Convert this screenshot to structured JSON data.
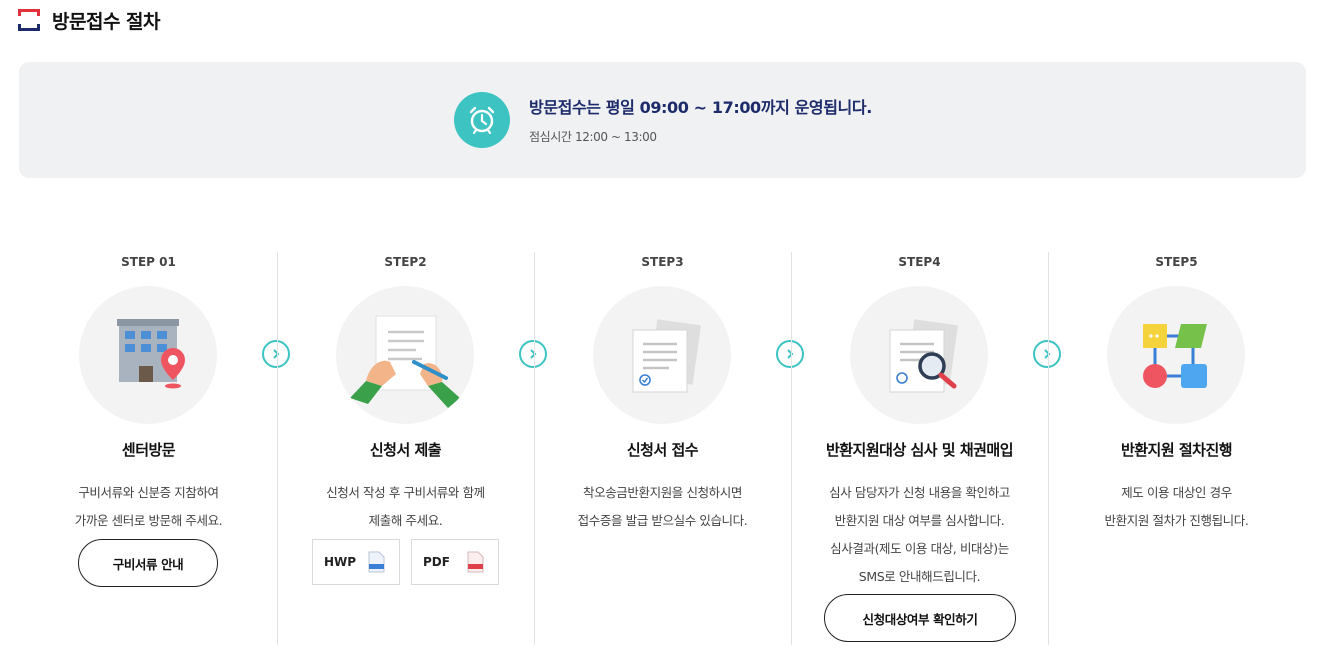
{
  "page": {
    "title": "방문접수 절차"
  },
  "notice": {
    "main": "방문접수는 평일 09:00 ~ 17:00까지 운영됩니다.",
    "sub": "점심시간 12:00 ~ 13:00",
    "icon": "alarm-clock-icon"
  },
  "colors": {
    "accent": "#3cc3c2",
    "navy": "#1d2b6b",
    "red": "#e0303b"
  },
  "steps": [
    {
      "label": "STEP 01",
      "title": "센터방문",
      "desc": [
        "구비서류와 신분증 지참하여",
        "가까운 센터로 방문해 주세요."
      ],
      "button": "구비서류 안내",
      "icon": "building-location-icon"
    },
    {
      "label": "STEP2",
      "title": "신청서 제출",
      "desc": [
        "신청서 작성 후 구비서류와 함께",
        "제출해 주세요."
      ],
      "files": [
        {
          "label": "HWP",
          "icon": "hwp-file-icon"
        },
        {
          "label": "PDF",
          "icon": "pdf-file-icon"
        }
      ],
      "icon": "hands-writing-icon"
    },
    {
      "label": "STEP3",
      "title": "신청서 접수",
      "desc": [
        "착오송금반환지원을 신청하시면",
        "접수증을 발급 받으실수 있습니다."
      ],
      "icon": "document-receipt-icon"
    },
    {
      "label": "STEP4",
      "title": "반환지원대상 심사 및 채권매입",
      "desc": [
        "심사 담당자가 신청 내용을 확인하고",
        "반환지원 대상 여부를 심사합니다.",
        "심사결과(제도 이용 대상, 비대상)는",
        "SMS로 안내해드립니다."
      ],
      "button": "신청대상여부 확인하기",
      "icon": "document-magnifier-icon"
    },
    {
      "label": "STEP5",
      "title": "반환지원 절차진행",
      "desc": [
        "제도 이용 대상인 경우",
        "반환지원 절차가 진행됩니다."
      ],
      "icon": "flowchart-icon"
    }
  ]
}
